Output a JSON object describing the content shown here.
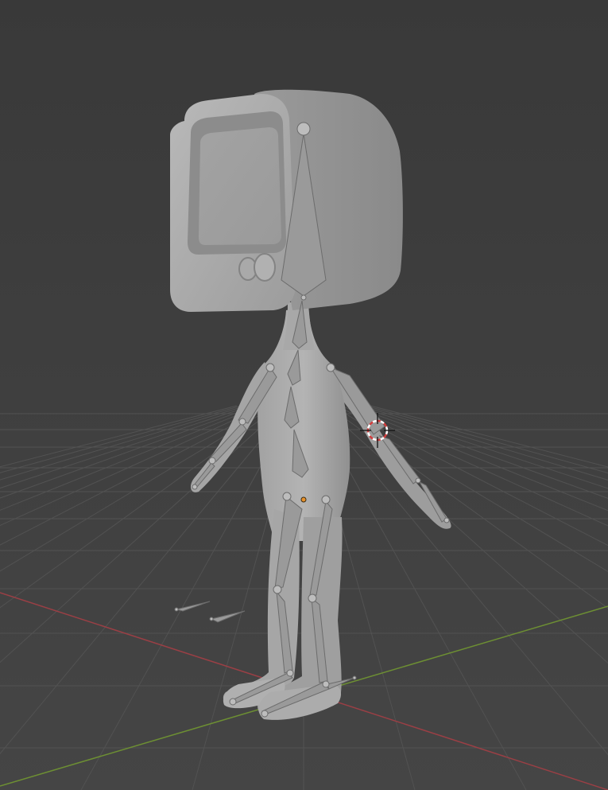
{
  "viewport": {
    "name": "3D Viewport",
    "background_top": "#3a3a3a",
    "background_bottom": "#444444",
    "grid_color": "#565656",
    "x_axis_color": "#9a3f45",
    "y_axis_color": "#6d8f33"
  },
  "scene": {
    "mesh": "character-body",
    "mesh_color": "#a9a9a9",
    "armature": "armature",
    "bone_color": "#9e9e9e",
    "head_shape": "tv-box",
    "cursor": "3d-cursor",
    "origin_color": "#e8922c"
  }
}
